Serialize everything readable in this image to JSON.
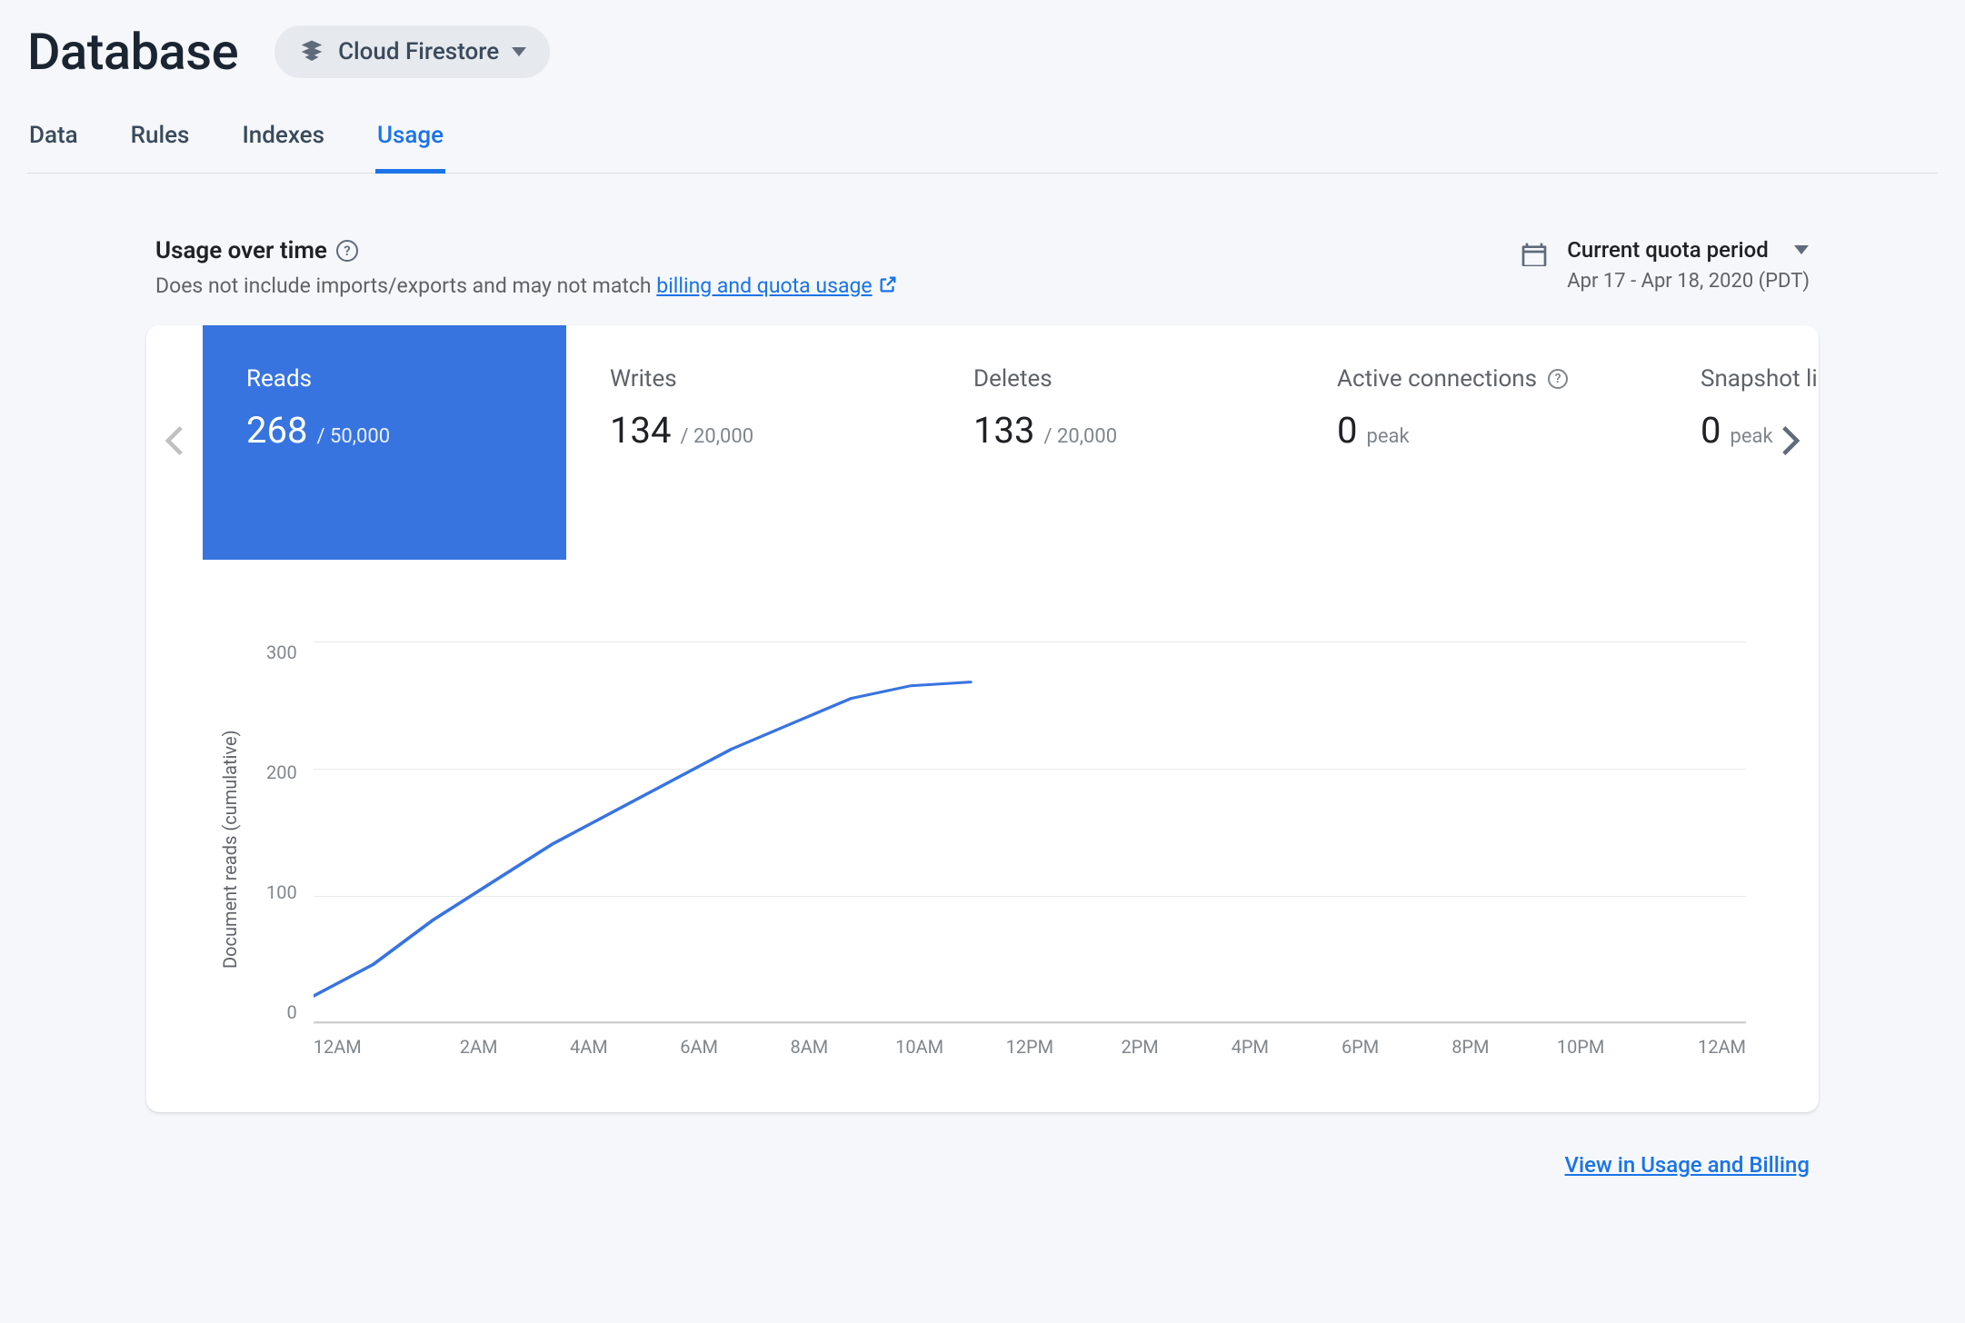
{
  "header": {
    "title": "Database",
    "selector_label": "Cloud Firestore"
  },
  "tabs": [
    {
      "label": "Data",
      "active": false
    },
    {
      "label": "Rules",
      "active": false
    },
    {
      "label": "Indexes",
      "active": false
    },
    {
      "label": "Usage",
      "active": true
    }
  ],
  "section": {
    "title": "Usage over time",
    "subtitle_prefix": "Does not include imports/exports and may not match ",
    "subtitle_link": "billing and quota usage"
  },
  "period": {
    "label": "Current quota period",
    "range": "Apr 17 - Apr 18, 2020 (PDT)"
  },
  "metrics": [
    {
      "label": "Reads",
      "value": "268",
      "limit": "/ 50,000",
      "active": true
    },
    {
      "label": "Writes",
      "value": "134",
      "limit": "/ 20,000"
    },
    {
      "label": "Deletes",
      "value": "133",
      "limit": "/ 20,000"
    },
    {
      "label": "Active connections",
      "value": "0",
      "limit": "peak",
      "help": true
    },
    {
      "label": "Snapshot listeners",
      "value": "0",
      "limit": "peak"
    }
  ],
  "chart_data": {
    "type": "line",
    "title": "",
    "xlabel": "",
    "ylabel": "Document reads (cumulative)",
    "ylim": [
      0,
      300
    ],
    "x_ticks": [
      "12AM",
      "2AM",
      "4AM",
      "6AM",
      "8AM",
      "10AM",
      "12PM",
      "2PM",
      "4PM",
      "6PM",
      "8PM",
      "10PM",
      "12AM"
    ],
    "y_ticks": [
      "300",
      "200",
      "100",
      "0"
    ],
    "x_hours": [
      0,
      1,
      2,
      3,
      4,
      5,
      6,
      7,
      8,
      9,
      10,
      11
    ],
    "values": [
      20,
      45,
      80,
      110,
      140,
      165,
      190,
      215,
      235,
      255,
      265,
      268
    ],
    "color": "#3874e0"
  },
  "footer": {
    "link_label": "View in Usage and Billing"
  }
}
